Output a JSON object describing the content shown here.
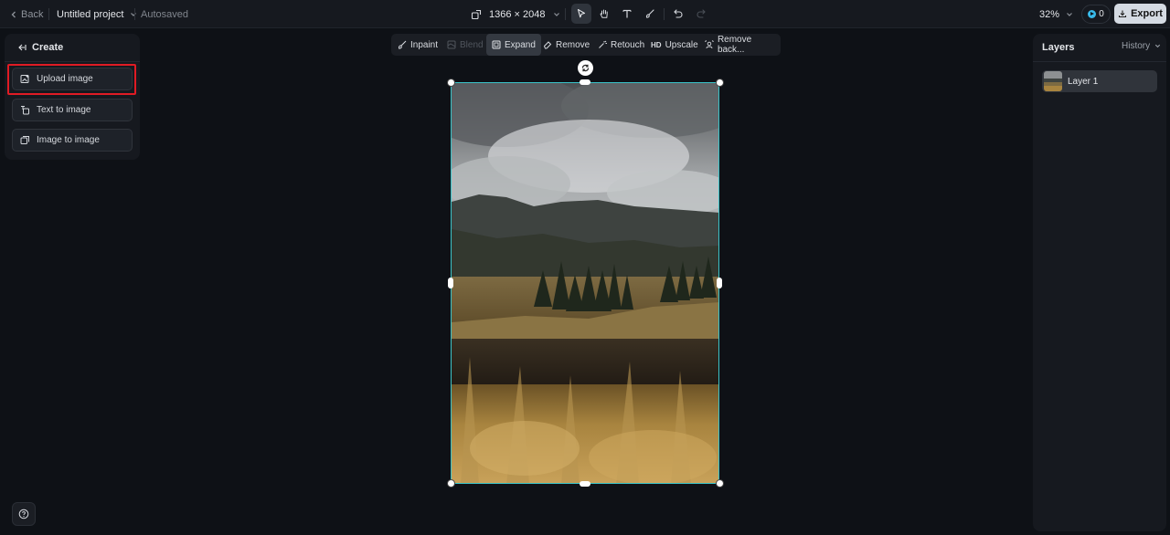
{
  "topbar": {
    "back_label": "Back",
    "project_title": "Untitled project",
    "autosaved_label": "Autosaved",
    "canvas_size": "1366 × 2048",
    "zoom": "32%",
    "credits": "0",
    "export_label": "Export"
  },
  "left_panel": {
    "create_label": "Create",
    "buttons": [
      {
        "label": "Upload image",
        "icon": "upload-image-icon"
      },
      {
        "label": "Text to image",
        "icon": "text-to-image-icon"
      },
      {
        "label": "Image to image",
        "icon": "image-to-image-icon"
      }
    ]
  },
  "canvas_toolbar": {
    "items": [
      {
        "label": "Inpaint",
        "icon": "brush-icon"
      },
      {
        "label": "Blend",
        "icon": "blend-icon",
        "disabled": true
      },
      {
        "label": "Expand",
        "icon": "expand-icon",
        "active": true
      },
      {
        "label": "Remove",
        "icon": "eraser-icon"
      },
      {
        "label": "Retouch",
        "icon": "magic-wand-icon"
      },
      {
        "label": "Upscale",
        "icon": "hd-icon",
        "icon_text": "HD"
      },
      {
        "label": "Remove back...",
        "icon": "remove-background-icon"
      }
    ]
  },
  "right_panel": {
    "layers_label": "Layers",
    "history_label": "History",
    "layers": [
      {
        "name": "Layer 1"
      }
    ]
  },
  "colors": {
    "background": "#0e1116",
    "panel": "#16191f",
    "selection": "#3ac3c8",
    "highlight": "#e01b24",
    "credit_accent": "#38b9e8",
    "export_button": "#d5dbe3"
  }
}
